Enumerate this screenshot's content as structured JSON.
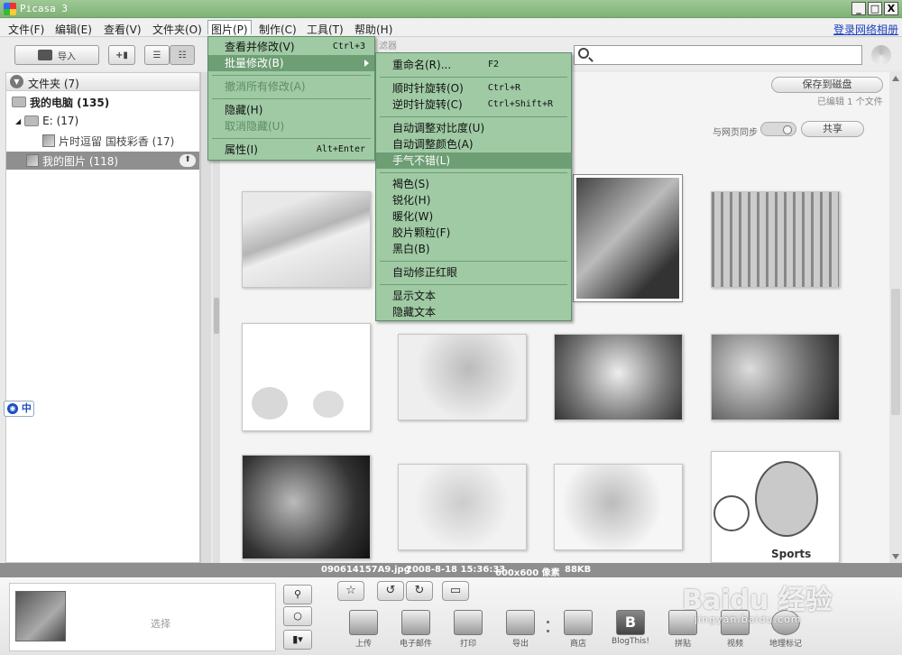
{
  "window": {
    "title": "Picasa 3",
    "min": "_",
    "max": "□",
    "close": "X"
  },
  "menubar": {
    "items": [
      {
        "label": "文件(F)"
      },
      {
        "label": "编辑(E)"
      },
      {
        "label": "查看(V)"
      },
      {
        "label": "文件夹(O)"
      },
      {
        "label": "图片(P)"
      },
      {
        "label": "制作(C)"
      },
      {
        "label": "工具(T)"
      },
      {
        "label": "帮助(H)"
      }
    ],
    "login": "登录网络相册"
  },
  "toolbar": {
    "import": "导入",
    "filter_label": "滤器"
  },
  "folders": {
    "header": "文件夹 (7)",
    "my_computer": "我的电脑 (135)",
    "drive_e": "E: (17)",
    "album_1": "片时逗留 国枝彩香 (17)",
    "my_pictures": "我的图片 (118)"
  },
  "content": {
    "save_to_disk": "保存到磁盘",
    "edited_count": "已编辑 1 个文件",
    "sync_label": "与网页同步",
    "share": "共享"
  },
  "picture_menu": {
    "items": [
      {
        "label": "查看并修改(V)",
        "accel": "Ctrl+3"
      },
      {
        "label": "批量修改(B)",
        "accel": ""
      },
      {
        "label": "撤消所有修改(A)",
        "accel": ""
      },
      {
        "label": "隐藏(H)",
        "accel": ""
      },
      {
        "label": "取消隐藏(U)",
        "accel": ""
      },
      {
        "label": "属性(I)",
        "accel": "Alt+Enter"
      }
    ]
  },
  "batch_menu": {
    "items": [
      {
        "label": "重命名(R)...",
        "accel": "F2"
      },
      {
        "label": "顺时针旋转(O)",
        "accel": "Ctrl+R"
      },
      {
        "label": "逆时针旋转(C)",
        "accel": "Ctrl+Shift+R"
      },
      {
        "label": "自动调整对比度(U)",
        "accel": ""
      },
      {
        "label": "自动调整颜色(A)",
        "accel": ""
      },
      {
        "label": "手气不错(L)",
        "accel": ""
      },
      {
        "label": "褐色(S)",
        "accel": ""
      },
      {
        "label": "锐化(H)",
        "accel": ""
      },
      {
        "label": "暖化(W)",
        "accel": ""
      },
      {
        "label": "胶片颗粒(F)",
        "accel": ""
      },
      {
        "label": "黑白(B)",
        "accel": ""
      },
      {
        "label": "自动修正红眼",
        "accel": ""
      },
      {
        "label": "显示文本",
        "accel": ""
      },
      {
        "label": "隐藏文本",
        "accel": ""
      }
    ]
  },
  "status": {
    "filename": "090614157A9.jpg",
    "datetime": "2008-8-18 15:36:33",
    "dimensions": "600x600 像素",
    "size": "88KB"
  },
  "tray": {
    "select": "选择",
    "actions": [
      {
        "label": "上传"
      },
      {
        "label": "电子邮件"
      },
      {
        "label": "打印"
      },
      {
        "label": "导出"
      },
      {
        "label": "商店"
      },
      {
        "label": "BlogThis!"
      },
      {
        "label": "拼贴"
      },
      {
        "label": "视频"
      },
      {
        "label": "地理标记"
      }
    ]
  },
  "thumbnail_captions": {
    "sports": "Sports"
  },
  "ime": {
    "label": "中"
  },
  "watermark": {
    "main": "Baidu 经验",
    "sub": "jingyan.baidu.com"
  }
}
